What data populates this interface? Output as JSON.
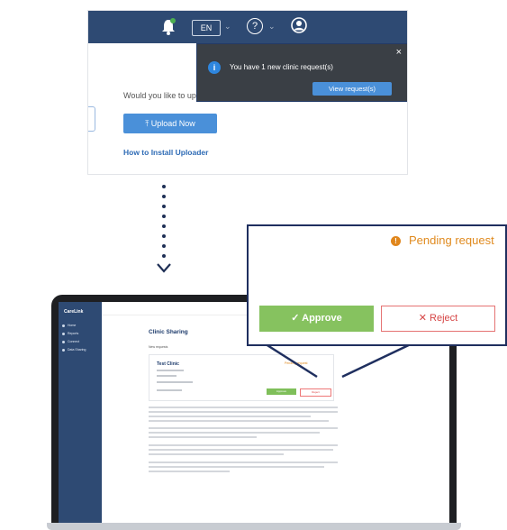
{
  "topbar": {
    "language": "EN",
    "help_glyph": "?",
    "notification_badge": ""
  },
  "top_screen": {
    "prompt_text": "Would you like to uplo",
    "upload_button": "Upload Now",
    "how_to_link": "How to Install Uploader"
  },
  "notification": {
    "info_glyph": "i",
    "message": "You have 1 new clinic request(s)",
    "view_button": "View request(s)",
    "close_glyph": "×"
  },
  "laptop": {
    "brand": "CareLink",
    "sidebar_items": [
      "Home",
      "Reports",
      "Connect",
      "Data Sharing"
    ],
    "page_title": "Clinic Sharing",
    "new_requests_label": "New requests",
    "clinic_name": "Test Clinic",
    "pending_small": "Pending request",
    "approve_small": "Approve",
    "reject_small": "Reject"
  },
  "zoom": {
    "pending_label": "Pending request",
    "approve_label": "Approve",
    "approve_glyph": "✓",
    "reject_label": "Reject",
    "reject_glyph": "✕"
  },
  "colors": {
    "navy": "#2e4a73",
    "accent_blue": "#4a90d9",
    "approve_green": "#86c25f",
    "reject_red": "#d64545",
    "pending_orange": "#e08a1e"
  }
}
